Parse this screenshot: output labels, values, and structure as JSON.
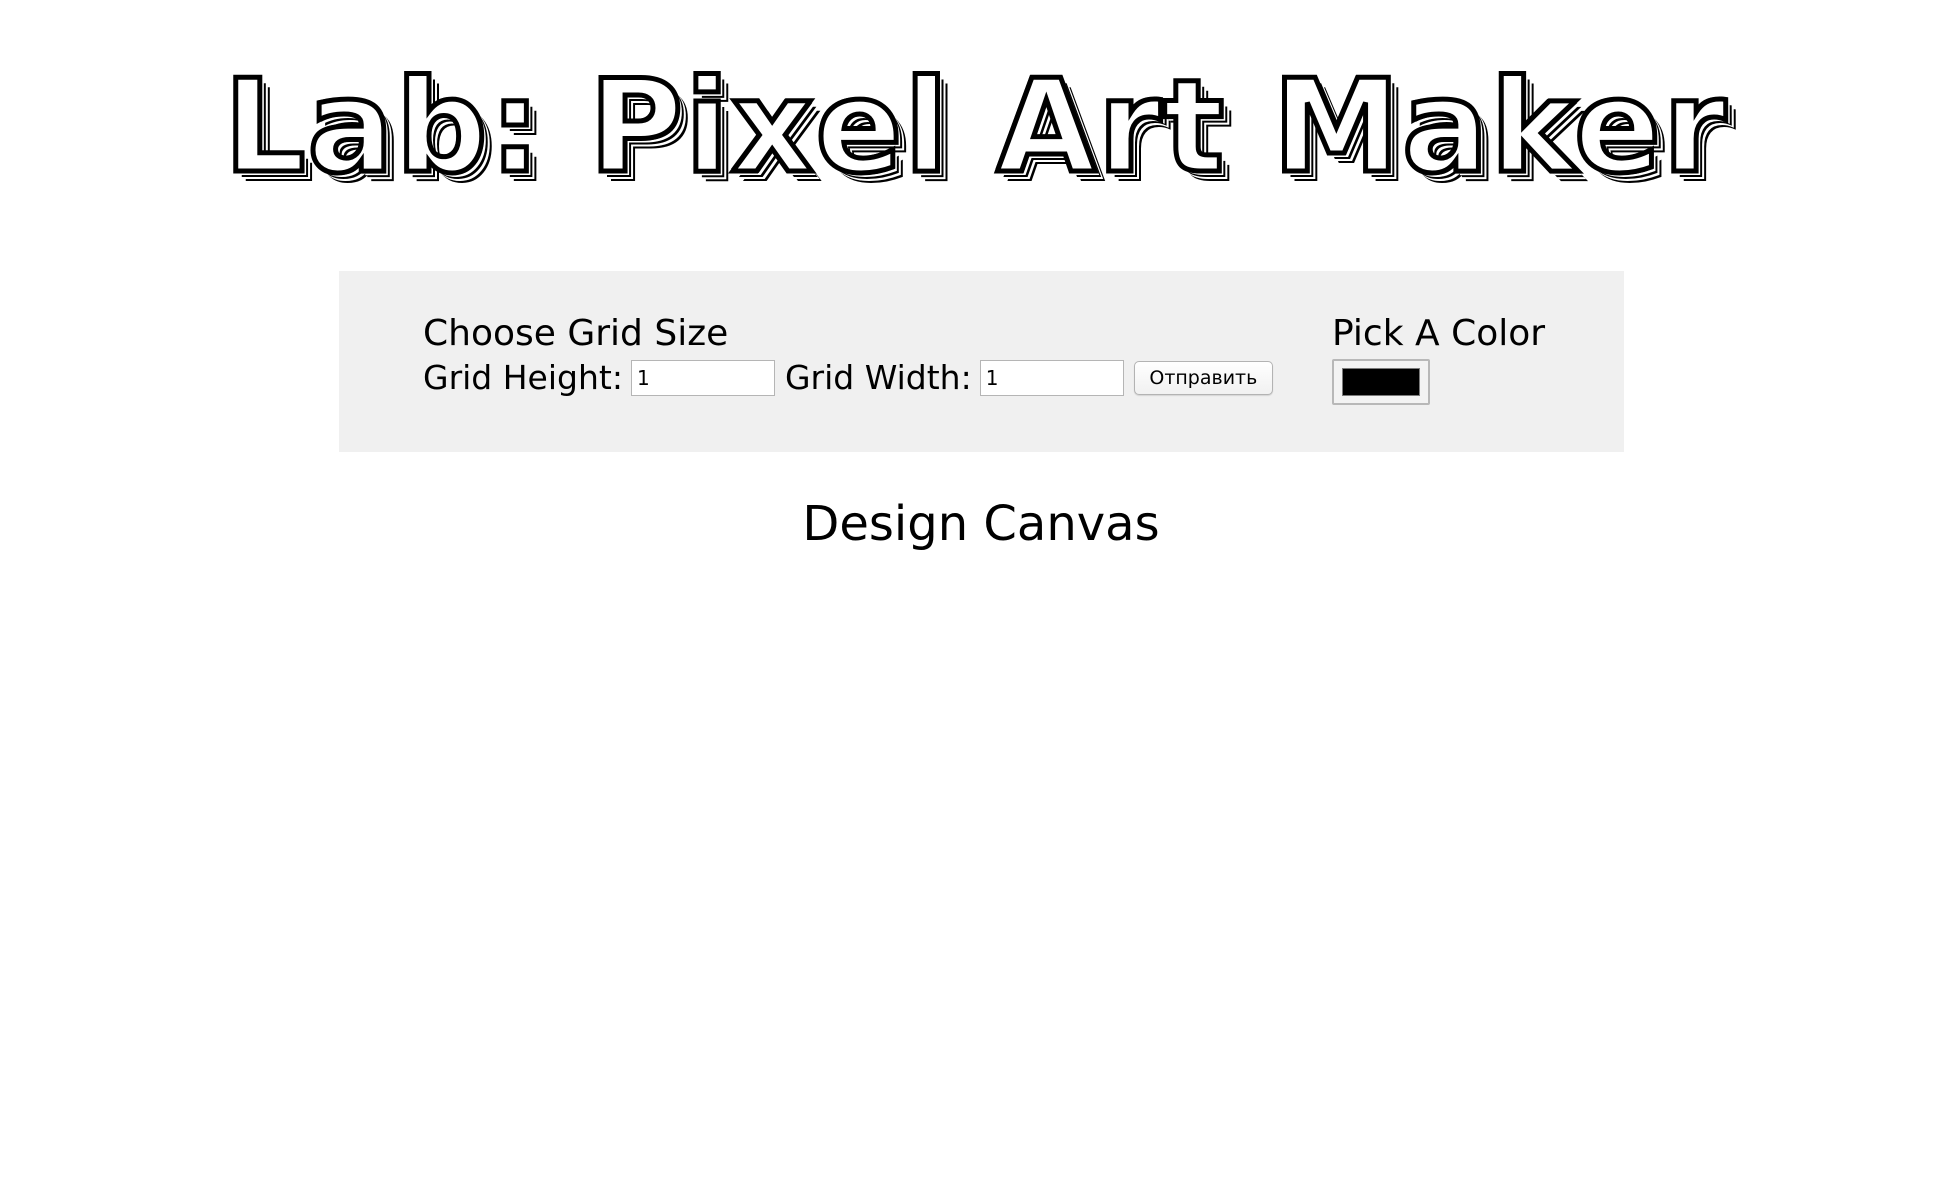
{
  "header": {
    "title": "Lab: Pixel Art Maker"
  },
  "grid_form": {
    "heading": "Choose Grid Size",
    "height_label": "Grid Height:",
    "height_value": "1",
    "width_label": "Grid Width:",
    "width_value": "1",
    "submit_label": "Отправить"
  },
  "color_picker": {
    "heading": "Pick A Color",
    "value": "#000000"
  },
  "canvas": {
    "heading": "Design Canvas"
  },
  "colors": {
    "panel_background": "#f0f0f0",
    "page_background": "#ffffff",
    "selected_color": "#000000"
  }
}
